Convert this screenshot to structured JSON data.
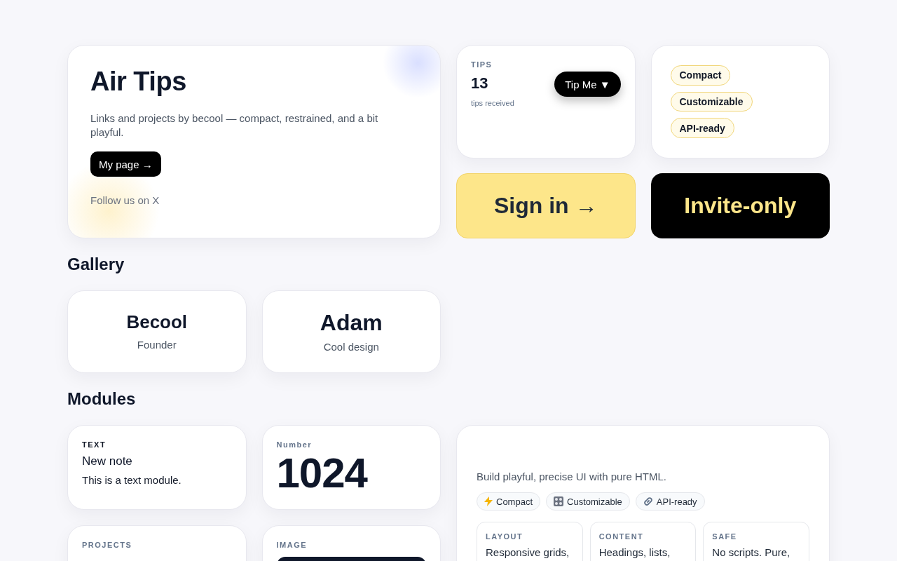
{
  "hero": {
    "title": "Air Tips",
    "description": "Links and projects by becool — compact, restrained, and a bit playful.",
    "button": "My page →",
    "link": "Follow us on X"
  },
  "tips": {
    "label": "TIPS",
    "count": "13",
    "caption": "tips received",
    "button": "Tip Me ▼"
  },
  "tags": [
    "Compact",
    "Customizable",
    "API-ready"
  ],
  "sign_in": {
    "label": "Sign in →"
  },
  "invite": {
    "label": "Invite-only"
  },
  "gallery": {
    "heading": "Gallery",
    "items": [
      {
        "name": "Becool",
        "role": "Founder",
        "kind": "regular"
      },
      {
        "name": "Adam",
        "role": "Cool design",
        "kind": "large"
      }
    ]
  },
  "modules": {
    "heading": "Modules",
    "items": [
      {
        "kind": "text",
        "label": "TEXT",
        "title": "New note",
        "body": "This is a text module."
      },
      {
        "kind": "number",
        "label": "Number",
        "value": "1024"
      },
      {
        "kind": "showcase",
        "tagline": "Build playful, precise UI with pure HTML.",
        "chips": [
          "Compact",
          "Customizable",
          "API-ready"
        ],
        "features": [
          {
            "label": "LAYOUT",
            "text": "Responsive grids,"
          },
          {
            "label": "CONTENT",
            "text": "Headings, lists,"
          },
          {
            "label": "SAFE",
            "text": "No scripts. Pure,"
          }
        ]
      },
      {
        "kind": "projects",
        "label": "PROJECTS"
      },
      {
        "kind": "image",
        "label": "IMAGE"
      }
    ]
  }
}
